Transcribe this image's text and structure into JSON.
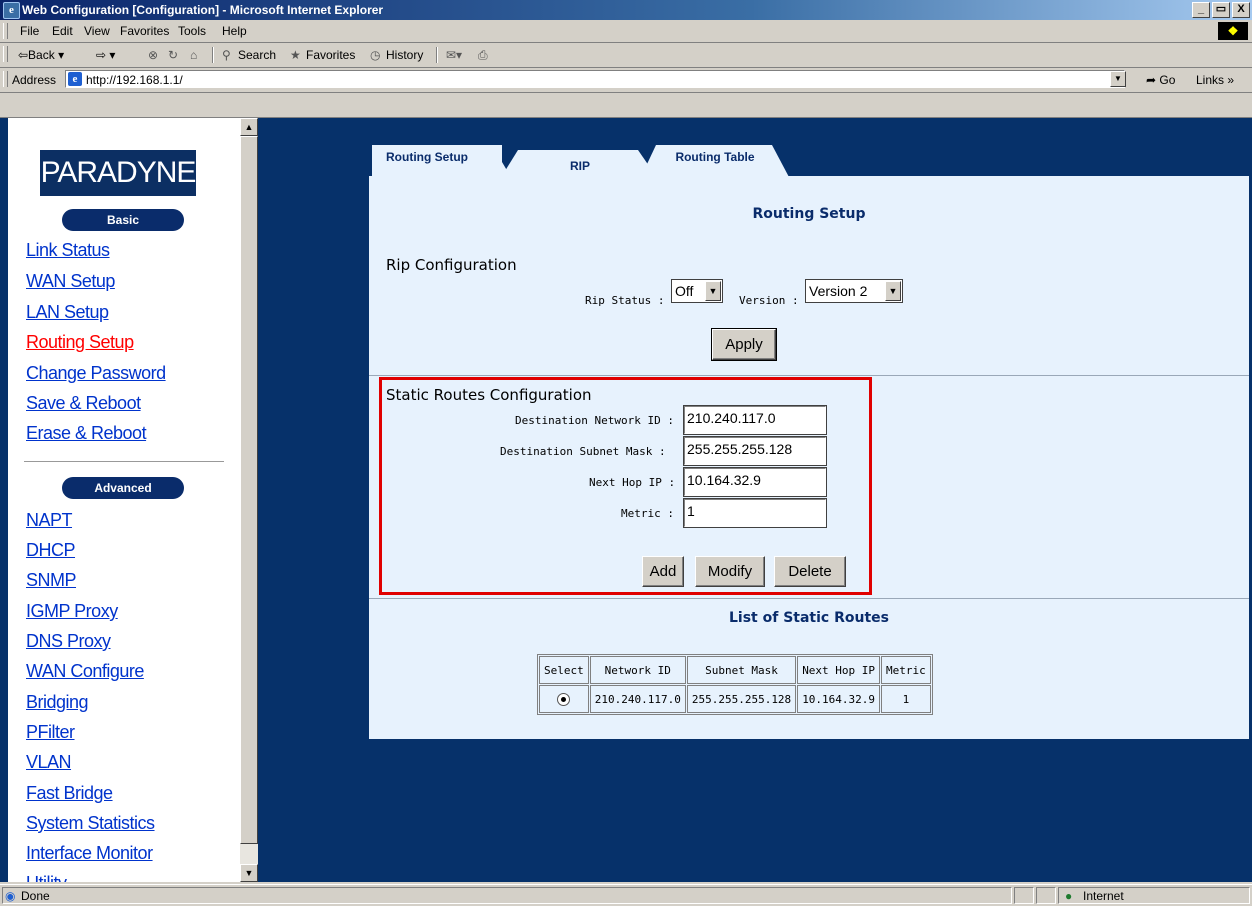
{
  "window": {
    "title": "Web Configuration [Configuration] - Microsoft Internet Explorer",
    "minimize": "_",
    "maximize": "8",
    "close": "X"
  },
  "menu": {
    "items": [
      "File",
      "Edit",
      "View",
      "Favorites",
      "Tools",
      "Help"
    ]
  },
  "toolbar": {
    "back": "⇦Back ▾",
    "forward": "⇨ ▾",
    "search": "Search",
    "favorites": "Favorites",
    "history": "History"
  },
  "address": {
    "label": "Address",
    "url": "http://192.168.1.1/",
    "go": "Go",
    "links": "Links »"
  },
  "sidebar": {
    "logo": "PARADYNE",
    "basic_label": "Basic",
    "basic_links": [
      "Link Status",
      "WAN Setup",
      "LAN Setup",
      "Routing Setup",
      "Change Password",
      "Save & Reboot",
      "Erase & Reboot"
    ],
    "active_link": "Routing Setup",
    "advanced_label": "Advanced",
    "advanced_links": [
      "NAPT",
      "DHCP",
      "SNMP",
      "IGMP Proxy",
      "DNS Proxy",
      "WAN Configure",
      "Bridging",
      "PFilter",
      "VLAN",
      "Fast Bridge",
      "System Statistics",
      "Interface Monitor",
      "Utility"
    ]
  },
  "tabs": [
    "Routing Setup",
    "RIP",
    "Routing Table"
  ],
  "main": {
    "title": "Routing Setup",
    "rip": {
      "section_label": "Rip Configuration",
      "status_label": "Rip Status :",
      "status_value": "Off",
      "version_label": "Version :",
      "version_value": "Version 2",
      "apply": "Apply"
    },
    "static": {
      "section_label": "Static Routes Configuration",
      "dest_network_label": "Destination Network ID :",
      "dest_network_value": "210.240.117.0",
      "dest_mask_label": "Destination Subnet Mask :",
      "dest_mask_value": "255.255.255.128",
      "next_hop_label": "Next Hop IP :",
      "next_hop_value": "10.164.32.9",
      "metric_label": "Metric :",
      "metric_value": "1",
      "add": "Add",
      "modify": "Modify",
      "delete": "Delete"
    },
    "list": {
      "title": "List of Static Routes",
      "headers": [
        "Select",
        "Network ID",
        "Subnet Mask",
        "Next Hop IP",
        "Metric"
      ],
      "rows": [
        {
          "network": "210.240.117.0",
          "mask": "255.255.255.128",
          "next_hop": "10.164.32.9",
          "metric": "1"
        }
      ]
    }
  },
  "status": {
    "text": "Done",
    "zone": "Internet"
  },
  "colors": {
    "page_bg": "#06316a",
    "panel_bg": "#e7f2fd",
    "active_link": "#ff0000",
    "link": "#0033cc",
    "highlight_box": "#e00000"
  }
}
